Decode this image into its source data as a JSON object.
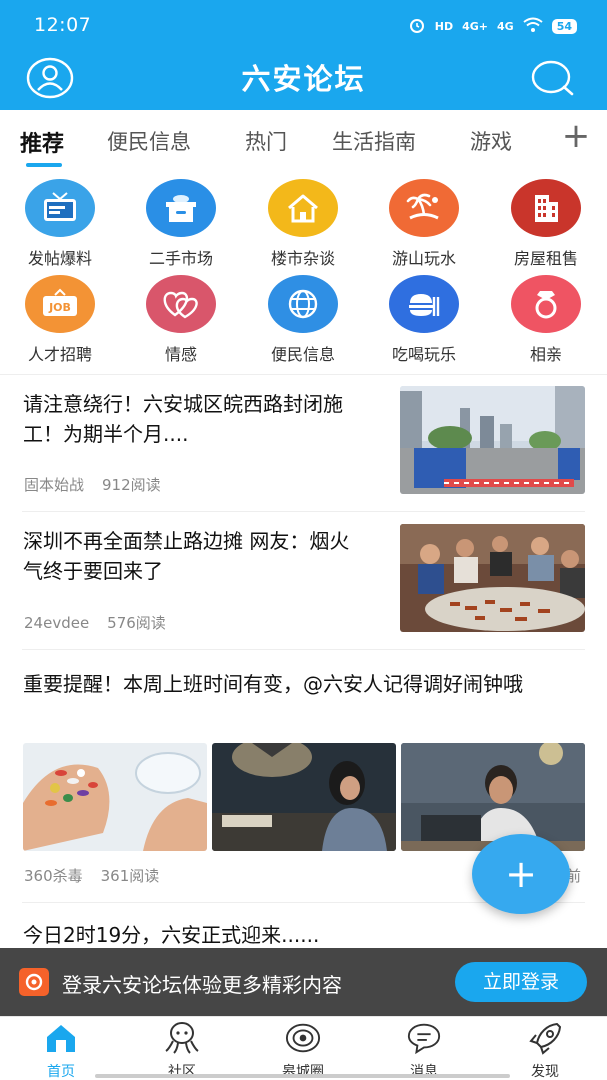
{
  "status_bar": {
    "time": "12:07",
    "network_badges": [
      "HD",
      "4G+",
      "4G"
    ],
    "battery": "54"
  },
  "header": {
    "title": "六安论坛",
    "color": "#1aa7ee",
    "left_icon": "user-icon",
    "right_icon": "search-icon"
  },
  "tabs": [
    {
      "label": "推荐",
      "active": true
    },
    {
      "label": "便民信息"
    },
    {
      "label": "热门"
    },
    {
      "label": "生活指南"
    },
    {
      "label": "游戏"
    }
  ],
  "tab_add_icon": "plus-icon",
  "categories": [
    {
      "label": "发帖爆料",
      "icon": "tv-news-icon",
      "color": "#3aa3e8"
    },
    {
      "label": "二手市场",
      "icon": "box-icon",
      "color": "#2a8fe6"
    },
    {
      "label": "楼市杂谈",
      "icon": "house-icon",
      "color": "#f3b81a"
    },
    {
      "label": "游山玩水",
      "icon": "palm-tree-icon",
      "color": "#f06a35"
    },
    {
      "label": "房屋租售",
      "icon": "building-icon",
      "color": "#c9352b"
    },
    {
      "label": "人才招聘",
      "icon": "job-icon",
      "color": "#f39335"
    },
    {
      "label": "情感",
      "icon": "hearts-icon",
      "color": "#d9566b"
    },
    {
      "label": "便民信息",
      "icon": "globe-icon",
      "color": "#2f8fe4"
    },
    {
      "label": "吃喝玩乐",
      "icon": "food-icon",
      "color": "#2f6fe0"
    },
    {
      "label": "相亲",
      "icon": "ring-icon",
      "color": "#ef5463"
    }
  ],
  "articles": [
    {
      "title": "请注意绕行！六安城区皖西路封闭施工！为期半个月....",
      "author": "固本始战",
      "reads": "912阅读",
      "image": "street-construction-image"
    },
    {
      "title": "深圳不再全面禁止路边摊 网友：烟火气终于要回来了",
      "author": "24evdee",
      "reads": "576阅读",
      "image": "street-barbecue-image"
    },
    {
      "title": "重要提醒！本周上班时间有变，@六安人记得调好闹钟哦",
      "author": "360杀毒",
      "reads": "361阅读",
      "time_suffix": "前",
      "images": [
        "pills-image",
        "woman-at-desk-image",
        "man-at-laptop-image"
      ]
    },
    {
      "title": "今日2时19分，六安正式迎来......"
    }
  ],
  "fab_icon": "plus-icon",
  "login_banner": {
    "text": "登录六安论坛体验更多精彩内容",
    "button": "立即登录"
  },
  "bottom_nav": [
    {
      "label": "首页",
      "icon": "home-icon",
      "active": true
    },
    {
      "label": "社区",
      "icon": "octopus-icon"
    },
    {
      "label": "皋城圈",
      "icon": "planet-icon"
    },
    {
      "label": "消息",
      "icon": "chat-icon"
    },
    {
      "label": "发现",
      "icon": "rocket-icon"
    }
  ]
}
